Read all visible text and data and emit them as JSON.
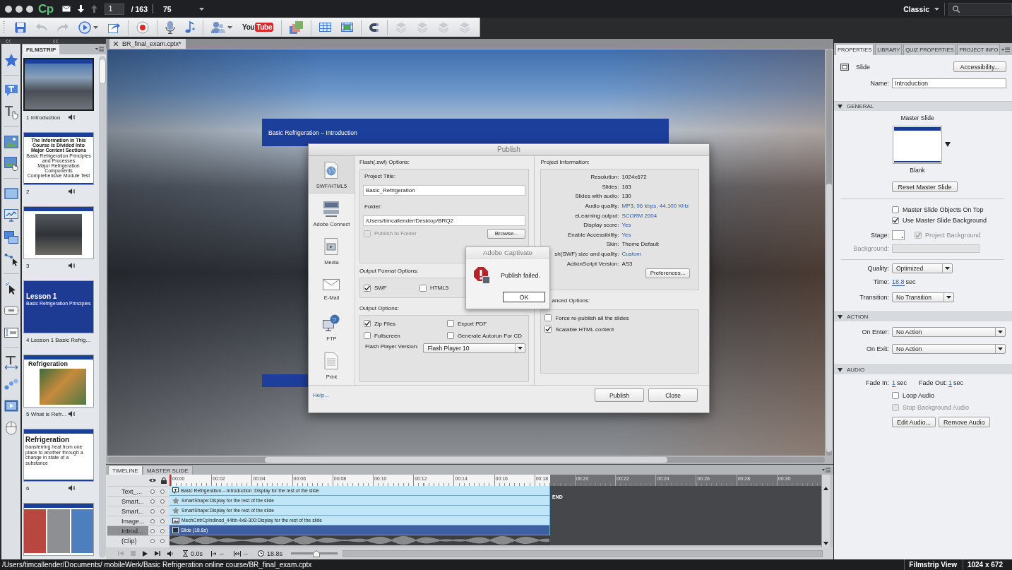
{
  "top_bar": {
    "logo": "Cp",
    "page_field": "1",
    "page_total": "/ 163",
    "zoom_field": "75",
    "workspace": "Classic"
  },
  "toolbar": {
    "youtube_logo": [
      "You",
      "Tube"
    ]
  },
  "filmstrip": {
    "tab": "FILMSTRIP",
    "slides": [
      {
        "kind": "photo",
        "label": "1 Introduction",
        "audio": true,
        "selected": true
      },
      {
        "kind": "text",
        "label": "2",
        "audio": true,
        "selected": false,
        "heading": "The Information in This Course is Divided Into Major Content Sections",
        "lines": [
          "Basic Refrigeration Principles and Processes",
          "Major Refrigeration Components",
          "Comprehensive Module Test"
        ]
      },
      {
        "kind": "photo",
        "label": "3",
        "audio": true,
        "selected": false
      },
      {
        "kind": "lesson",
        "label": "4 Lesson 1 Basic Refrig...",
        "audio": false,
        "selected": false,
        "heading": "Lesson 1",
        "lines": [
          "Basic Refrigeration Principles"
        ]
      },
      {
        "kind": "photo_title",
        "label": "5 What is Refr...",
        "audio": true,
        "selected": false,
        "heading": "Refrigeration"
      },
      {
        "kind": "title",
        "label": "6",
        "audio": true,
        "selected": false,
        "heading": "Refrigeration",
        "lines": [
          "transferring heat from one place to another through a change in state of a substance"
        ]
      },
      {
        "kind": "photo_split",
        "selected": false
      }
    ]
  },
  "stage": {
    "document_tab": "BR_final_exam.cptx*",
    "slide_title": "Basic Refrigeration – Introduction"
  },
  "publish_dialog": {
    "title": "Publish",
    "categories": [
      {
        "kind": "swf",
        "label": "SWF/HTML5",
        "selected": true
      },
      {
        "kind": "connect",
        "label": "Adobe Connect",
        "selected": false
      },
      {
        "kind": "media",
        "label": "Media",
        "selected": false
      },
      {
        "kind": "email",
        "label": "E-Mail",
        "selected": false
      },
      {
        "kind": "ftp",
        "label": "FTP",
        "selected": false
      },
      {
        "kind": "print",
        "label": "Print",
        "selected": false
      }
    ],
    "flash_options_heading": "Flash(.swf) Options:",
    "project_title_label": "Project Title:",
    "project_title_value": "Basic_Refrigeration",
    "folder_label": "Folder:",
    "folder_value": "/Users/timcallender/Desktop/BRQ2",
    "publish_to_folder": {
      "label": "Publish to Folder",
      "checked": false,
      "disabled": true
    },
    "browse_button": "Browse...",
    "output_format_heading": "Output Format Options:",
    "output_formats": [
      {
        "label": "SWF",
        "checked": true
      },
      {
        "label": "HTML5",
        "checked": false
      }
    ],
    "output_options_heading": "Output Options:",
    "output_options": [
      {
        "label": "Zip Files",
        "checked": true
      },
      {
        "label": "Export PDF",
        "checked": false
      },
      {
        "label": "Fullscreen",
        "checked": false
      },
      {
        "label": "Generate Autorun For CD",
        "checked": false
      }
    ],
    "flash_player_label": "Flash Player Version:",
    "flash_player_value": "Flash Player 10",
    "project_info_heading": "Project Information:",
    "project_info": [
      {
        "label": "Resolution:",
        "value": "1024x672",
        "link": false
      },
      {
        "label": "Slides:",
        "value": "163",
        "link": false
      },
      {
        "label": "Slides with audio:",
        "value": "130",
        "link": false
      },
      {
        "label": "Audio quality:",
        "value": "MP3, 96 kbps, 44.100 KHz",
        "link": true
      },
      {
        "label": "eLearning output:",
        "value": "SCORM 2004",
        "link": true
      },
      {
        "label": "Display score:",
        "value": "Yes",
        "link": true
      },
      {
        "label": "Enable Accessibility:",
        "value": "Yes",
        "link": true
      },
      {
        "label": "Skin:",
        "value": "Theme Default",
        "link": false
      },
      {
        "label": "sh(SWF) size and quality:",
        "value": "Custom",
        "link": true
      },
      {
        "label": "ActionScript Version:",
        "value": "AS3",
        "link": false
      }
    ],
    "preferences_button": "Preferences...",
    "advanced_heading": "anced Options:",
    "advanced_options": [
      {
        "label": "Force re-publish all the slides",
        "checked": false
      },
      {
        "label": "Scalable HTML content",
        "checked": true
      }
    ],
    "help_link": "Help...",
    "buttons": [
      "Publish",
      "Close"
    ]
  },
  "alert": {
    "title": "Adobe Captivate",
    "message": "Publish failed.",
    "button": "OK"
  },
  "timeline": {
    "tabs": [
      {
        "label": "TIMELINE",
        "selected": true
      },
      {
        "label": "MASTER SLIDE",
        "selected": false
      }
    ],
    "ruler": [
      "00:00",
      "00:02",
      "00:04",
      "00:06",
      "00:08",
      "00:10",
      "00:12",
      "00:14",
      "00:16",
      "00:18",
      "00:20",
      "00:22",
      "00:24",
      "00:26",
      "00:28",
      "00:30"
    ],
    "end_label": "END",
    "rows": [
      {
        "kind": "caption",
        "name": "Text_...",
        "bar": "Basic Refrigeration – Introduction :Display for the rest of the slide",
        "selected": false
      },
      {
        "kind": "shape",
        "name": "Smart...",
        "bar": "SmartShape:Display for the rest of the slide",
        "selected": false
      },
      {
        "kind": "shape",
        "name": "Smart...",
        "bar": "SmartShape:Display for the rest of the slide",
        "selected": false
      },
      {
        "kind": "image",
        "name": "Image...",
        "bar": "MechCntrCplndInsd_44bb-4x8-300:Display for the rest of the slide",
        "selected": false
      },
      {
        "kind": "slide",
        "name": "Introd...",
        "bar": "Slide (18.8s)",
        "selected": true
      },
      {
        "kind": "audio",
        "name": "(Clip)",
        "selected": false
      }
    ],
    "controls": {
      "start_time": "0.0s",
      "in_point": "--",
      "duration_point": "--",
      "total_time": "18.8s"
    },
    "zoom_slider": {
      "level": 0.54
    }
  },
  "properties": {
    "tabs": [
      {
        "label": "PROPERTIES",
        "selected": true
      },
      {
        "label": "LIBRARY",
        "selected": false
      },
      {
        "label": "QUIZ PROPERTIES",
        "selected": false
      },
      {
        "label": "PROJECT INFO",
        "selected": false
      }
    ],
    "object_type": "Slide",
    "accessibility_button": "Accessibility...",
    "name_label": "Name:",
    "name_value": "Introduction",
    "general": {
      "title": "GENERAL",
      "expanded": true,
      "master_slide_label": "Master Slide",
      "master_slide_name": "Blank",
      "reset_button": "Reset Master Slide",
      "checkboxes": [
        {
          "label": "Master Slide Objects On Top",
          "checked": false
        },
        {
          "label": "Use Master Slide Background",
          "checked": true
        }
      ],
      "stage_label": "Stage:",
      "project_background": {
        "label": "Project Background",
        "checked": true,
        "disabled": true
      },
      "background": {
        "label": "Background:",
        "disabled": true
      },
      "quality_label": "Quality:",
      "quality_value": "Optimized",
      "time_label": "Time:",
      "time_value": "18.8",
      "time_unit": "sec",
      "transition_label": "Transition:",
      "transition_value": "No Transition"
    },
    "action": {
      "title": "ACTION",
      "expanded": true,
      "rows": [
        {
          "label": "On Enter:",
          "value": "No Action"
        },
        {
          "label": "On Exit:",
          "value": "No Action"
        }
      ]
    },
    "audio": {
      "title": "AUDIO",
      "expanded": true,
      "fade_in_label": "Fade In:",
      "fade_in_value": "1",
      "fade_in_unit": "sec",
      "fade_out_label": "Fade Out:",
      "fade_out_value": "1",
      "fade_out_unit": "sec",
      "checkboxes": [
        {
          "label": "Loop Audio",
          "checked": false,
          "disabled": false
        },
        {
          "label": "Stop Background Audio",
          "checked": false,
          "disabled": true
        }
      ],
      "buttons": [
        "Edit Audio...",
        "Remove Audio"
      ]
    }
  },
  "status_bar": {
    "path": "/Users/timcallender/Documents/ mobileWerk/Basic Refrigeration online course/BR_final_exam.cptx",
    "view": "Filmstrip View",
    "resolution": "1024 x 672"
  }
}
